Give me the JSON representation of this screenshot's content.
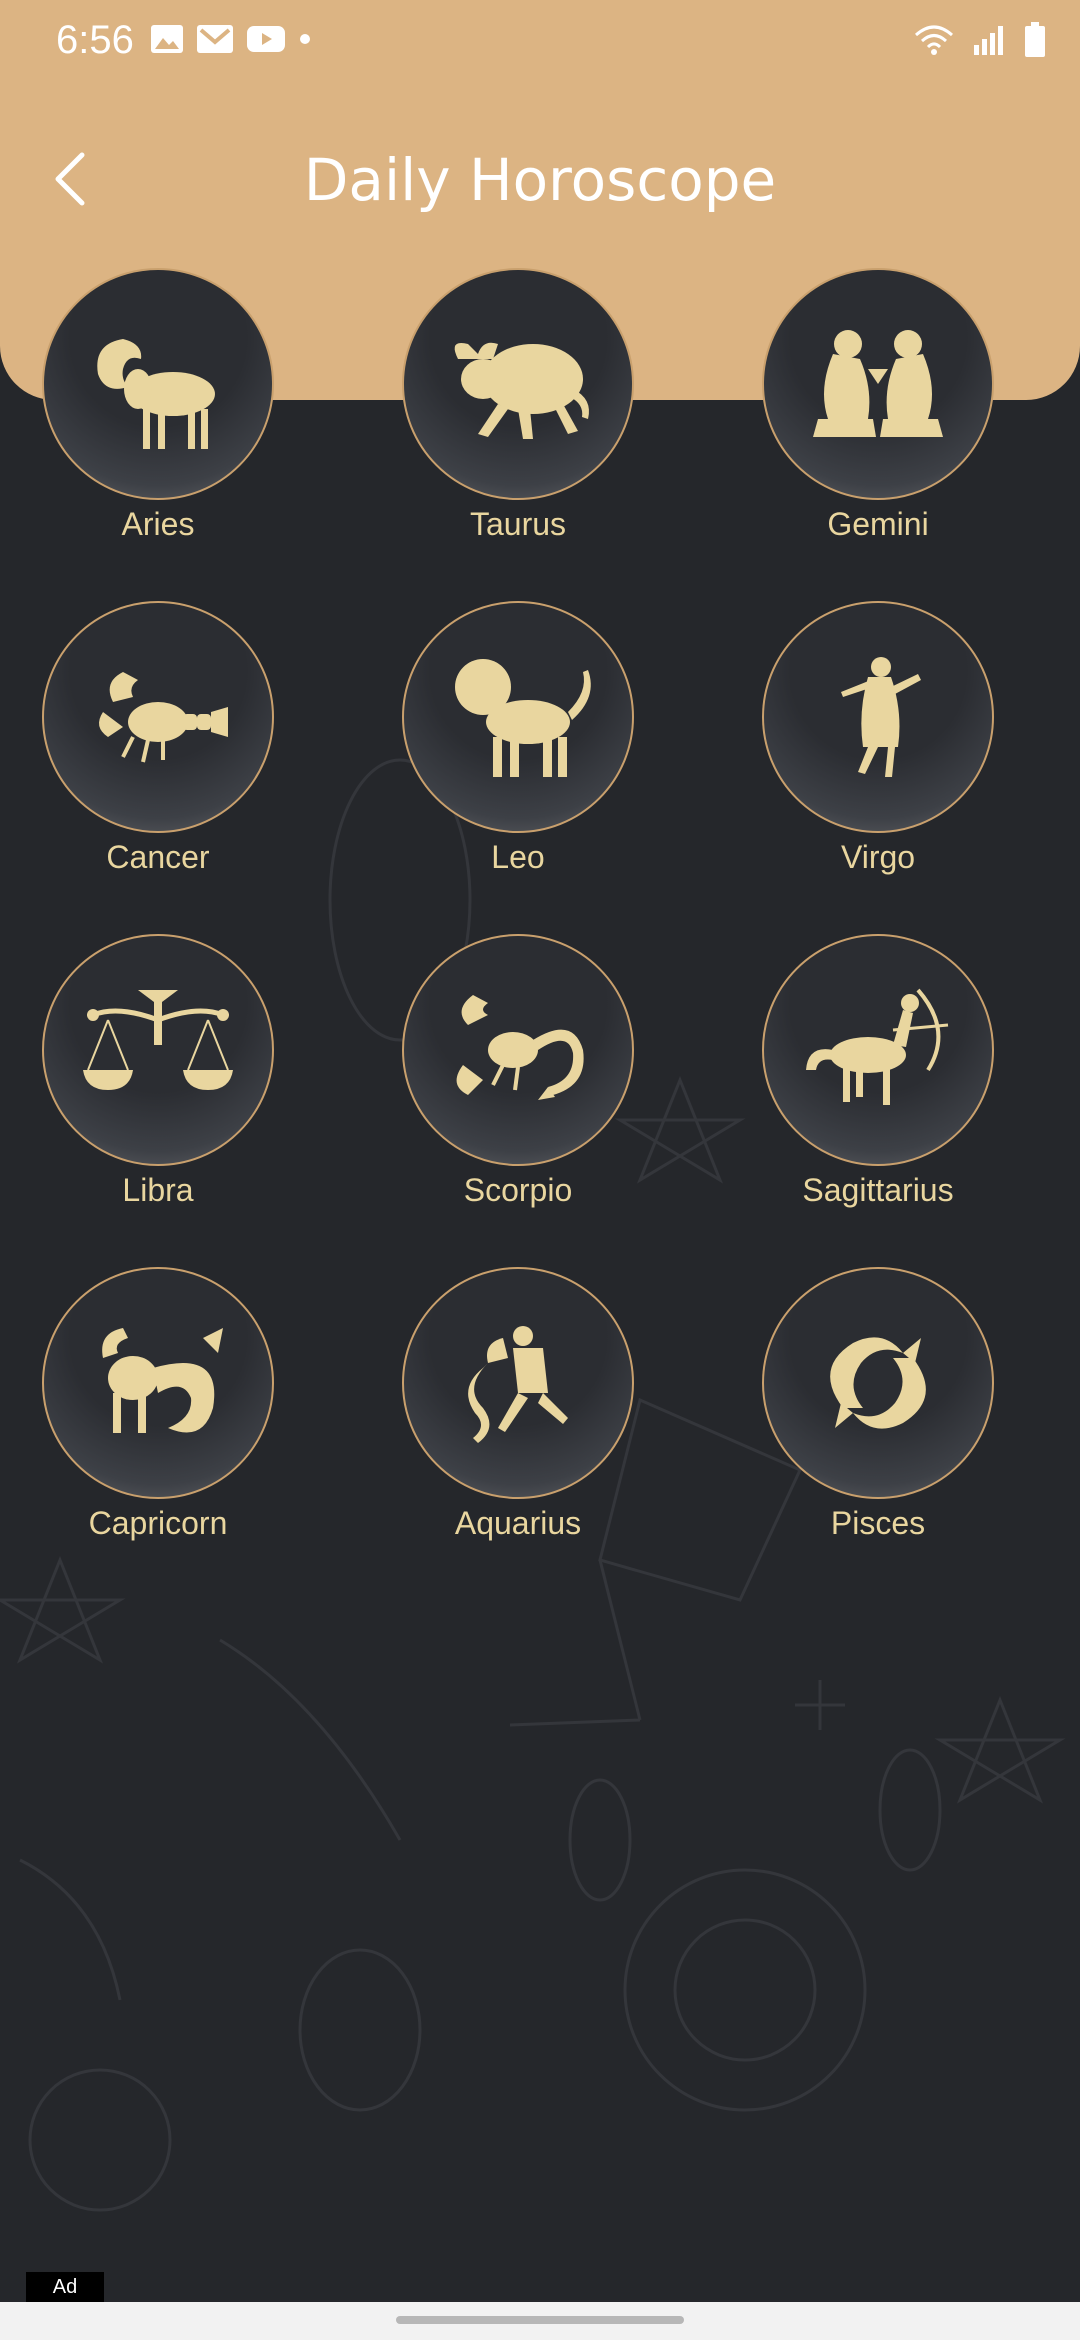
{
  "status_bar": {
    "time": "6:56",
    "left_icons": [
      "gallery-icon",
      "gmail-icon",
      "youtube-icon",
      "dot-icon"
    ],
    "right_icons": [
      "wifi-icon",
      "signal-icon",
      "battery-icon"
    ]
  },
  "header": {
    "title": "Daily Horoscope",
    "background_color": "#dcb483"
  },
  "signs": [
    {
      "label": "Aries",
      "icon": "aries-ram-icon"
    },
    {
      "label": "Taurus",
      "icon": "taurus-bull-icon"
    },
    {
      "label": "Gemini",
      "icon": "gemini-twins-icon"
    },
    {
      "label": "Cancer",
      "icon": "cancer-crab-icon"
    },
    {
      "label": "Leo",
      "icon": "leo-lion-icon"
    },
    {
      "label": "Virgo",
      "icon": "virgo-maiden-icon"
    },
    {
      "label": "Libra",
      "icon": "libra-scales-icon"
    },
    {
      "label": "Scorpio",
      "icon": "scorpio-scorpion-icon"
    },
    {
      "label": "Sagittarius",
      "icon": "sagittarius-archer-icon"
    },
    {
      "label": "Capricorn",
      "icon": "capricorn-goat-icon"
    },
    {
      "label": "Aquarius",
      "icon": "aquarius-water-bearer-icon"
    },
    {
      "label": "Pisces",
      "icon": "pisces-fish-icon"
    }
  ],
  "ad": {
    "label": "Ad"
  },
  "colors": {
    "accent_gold": "#e9d69f",
    "background": "#25272b"
  }
}
